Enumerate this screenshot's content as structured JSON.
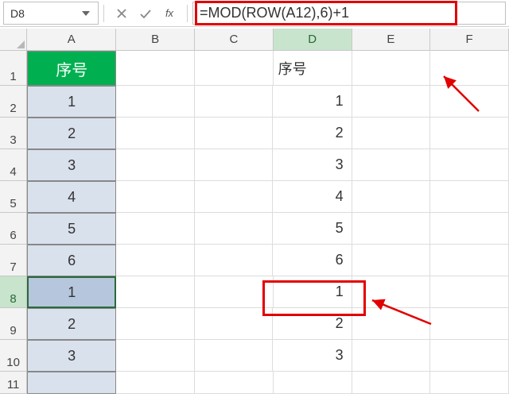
{
  "namebox": {
    "value": "D8"
  },
  "formula": {
    "value": "=MOD(ROW(A12),6)+1"
  },
  "columns": [
    "A",
    "B",
    "C",
    "D",
    "E",
    "F"
  ],
  "active_col": "D",
  "active_row": 8,
  "colA": {
    "header": "序号",
    "values": [
      "1",
      "2",
      "3",
      "4",
      "5",
      "6",
      "1",
      "2",
      "3"
    ],
    "selected_index": 6
  },
  "colD": {
    "header": "序号",
    "values": [
      "1",
      "2",
      "3",
      "4",
      "5",
      "6",
      "1",
      "2",
      "3"
    ]
  },
  "row_count": 10
}
